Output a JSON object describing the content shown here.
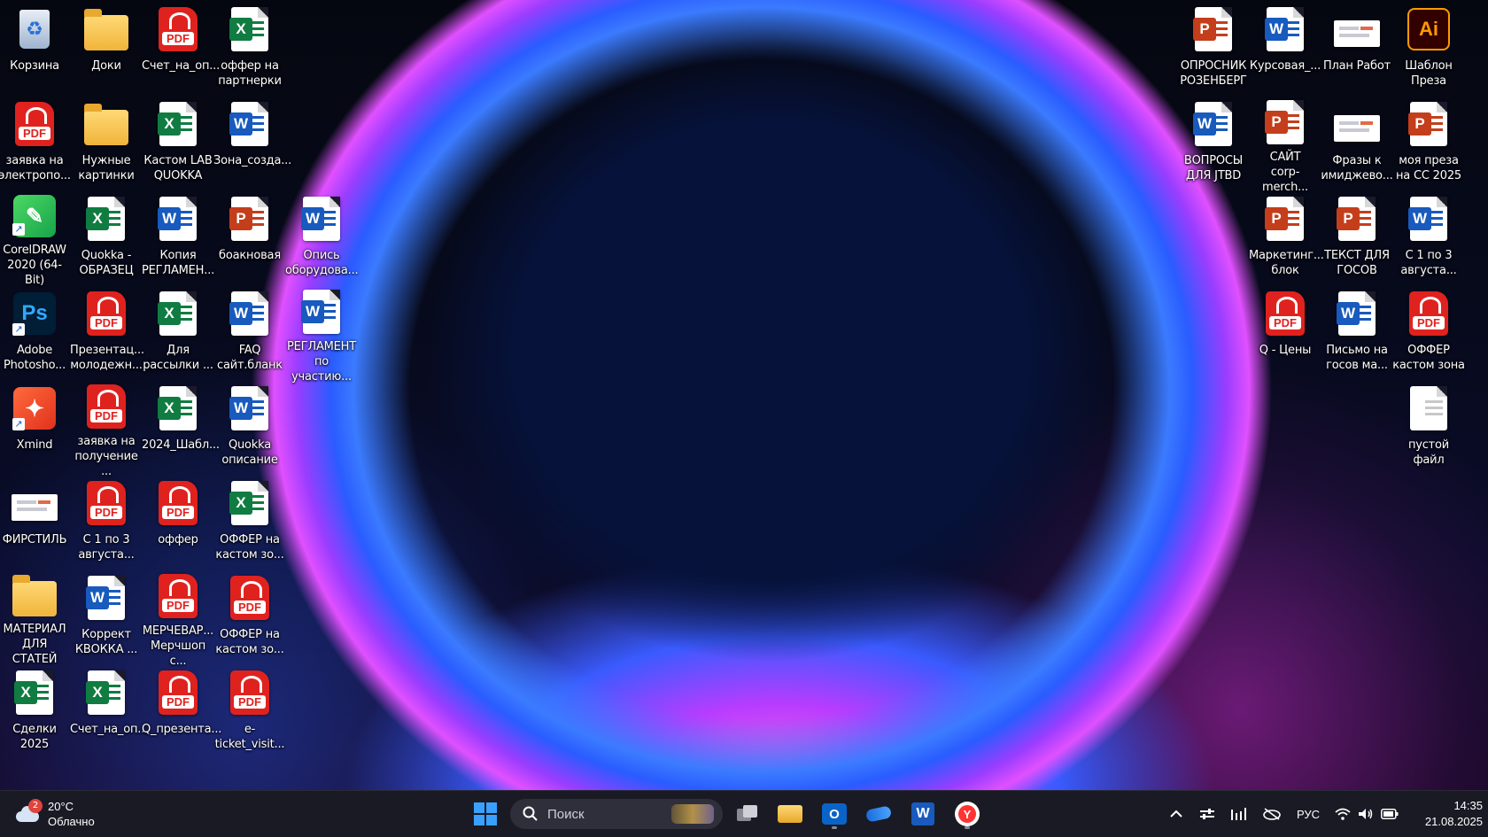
{
  "desktop": {
    "left_icons": [
      {
        "label": "Корзина",
        "kind": "recycle"
      },
      {
        "label": "Доки",
        "kind": "folder"
      },
      {
        "label": "Счет_на_оп...",
        "kind": "pdf"
      },
      {
        "label": "оффер на\nпартнерки",
        "kind": "excel"
      },
      {
        "label": "заявка на\nэлектропо...",
        "kind": "pdf"
      },
      {
        "label": "Нужные\nкартинки",
        "kind": "folder"
      },
      {
        "label": "Кастом LAB\nQUOKKA",
        "kind": "excel"
      },
      {
        "label": "Зона_созда...",
        "kind": "word"
      },
      {
        "label": "CorelDRAW\n2020 (64-Bit)",
        "kind": "corel"
      },
      {
        "label": "Quokka -\nОБРАЗЕЦ",
        "kind": "excel"
      },
      {
        "label": "Копия\nРЕГЛАМЕН...",
        "kind": "word"
      },
      {
        "label": "боакновая",
        "kind": "ppt"
      },
      {
        "label": "Опись\nоборудова...",
        "kind": "word"
      },
      {
        "label": "Adobe\nPhotosho...",
        "kind": "ps"
      },
      {
        "label": "Презентац...\nмолодежн...",
        "kind": "pdf"
      },
      {
        "label": "Для\nрассылки ...",
        "kind": "excel"
      },
      {
        "label": "FAQ\nсайт.бланк",
        "kind": "word"
      },
      {
        "label": "РЕГЛАМЕНТ\nпо участию...",
        "kind": "word"
      },
      {
        "label": "Xmind",
        "kind": "xmind"
      },
      {
        "label": "заявка на\nполучение ...",
        "kind": "pdf"
      },
      {
        "label": "2024_Шабл...",
        "kind": "excel"
      },
      {
        "label": "Quokka\nописание",
        "kind": "word"
      },
      {
        "label": "ФИРСТИЛЬ",
        "kind": "thumb"
      },
      {
        "label": "С 1 по 3\nавгуста...",
        "kind": "pdf"
      },
      {
        "label": "оффер",
        "kind": "pdf"
      },
      {
        "label": "ОФФЕР на\nкастом зо...",
        "kind": "excel"
      },
      {
        "label": "МАТЕРИАЛ\nДЛЯ СТАТЕЙ",
        "kind": "folder"
      },
      {
        "label": "Коррект\nКВОККА ...",
        "kind": "word"
      },
      {
        "label": "МЕРЧЕВАР...\nМерчшоп с...",
        "kind": "pdf"
      },
      {
        "label": "ОФФЕР на\nкастом зо...",
        "kind": "pdf"
      },
      {
        "label": "Сделки 2025",
        "kind": "excel"
      },
      {
        "label": "Счет_на_оп...",
        "kind": "excel"
      },
      {
        "label": "Q_презента...",
        "kind": "pdf"
      },
      {
        "label": "e-ticket_visit...",
        "kind": "pdf"
      }
    ],
    "right_icons": [
      {
        "label": "ОПРОСНИК\nРОЗЕНБЕРГ",
        "kind": "ppt"
      },
      {
        "label": "Курсовая_...",
        "kind": "word"
      },
      {
        "label": "План Работ",
        "kind": "thumb"
      },
      {
        "label": "Шаблон\nПреза",
        "kind": "ai"
      },
      {
        "label": "ВОПРОСЫ\nДЛЯ JTBD",
        "kind": "word"
      },
      {
        "label": "САЙТ\ncorp-merch...",
        "kind": "ppt"
      },
      {
        "label": "Фразы к\nимиджево...",
        "kind": "thumb"
      },
      {
        "label": "моя преза\nна СС 2025",
        "kind": "ppt"
      },
      {
        "label": "Маркетинг...\nблок",
        "kind": "ppt"
      },
      {
        "label": "ТЕКСТ ДЛЯ\nГОСОВ",
        "kind": "ppt"
      },
      {
        "label": "С 1 по 3\nавгуста...",
        "kind": "word"
      },
      {
        "label": "Q - Цены",
        "kind": "pdf"
      },
      {
        "label": "Письмо на\nгосов ма...",
        "kind": "word"
      },
      {
        "label": "ОФФЕР\nкастом зона",
        "kind": "pdf"
      },
      {
        "label": "пустой файл",
        "kind": "blank"
      }
    ]
  },
  "taskbar": {
    "weather": {
      "temp": "20°C",
      "condition": "Облачно",
      "badge": "2"
    },
    "search": {
      "placeholder": "Поиск"
    },
    "language": "РУС",
    "time": "14:35",
    "date": "21.08.2025"
  },
  "colors": {
    "word": "#185abd",
    "excel": "#107c41",
    "ppt": "#c43e1c",
    "pdf": "#e0221f",
    "ps": "#001e36",
    "ai": "#330000"
  }
}
